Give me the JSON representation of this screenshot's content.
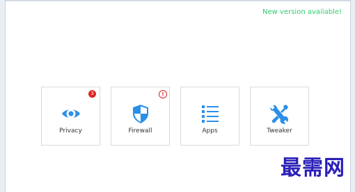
{
  "header": {
    "update_notice": "New version available!"
  },
  "tiles": [
    {
      "label": "Privacy",
      "icon": "eye-icon",
      "badge": "3"
    },
    {
      "label": "Firewall",
      "icon": "shield-icon",
      "badge": "!"
    },
    {
      "label": "Apps",
      "icon": "list-icon"
    },
    {
      "label": "Tweaker",
      "icon": "wrench-icon"
    }
  ],
  "watermark": {
    "text": "最需网"
  },
  "colors": {
    "accent": "#2b8fe8",
    "update_link": "#2ecc71",
    "badge": "#e02424",
    "watermark": "#2a1fb8"
  }
}
